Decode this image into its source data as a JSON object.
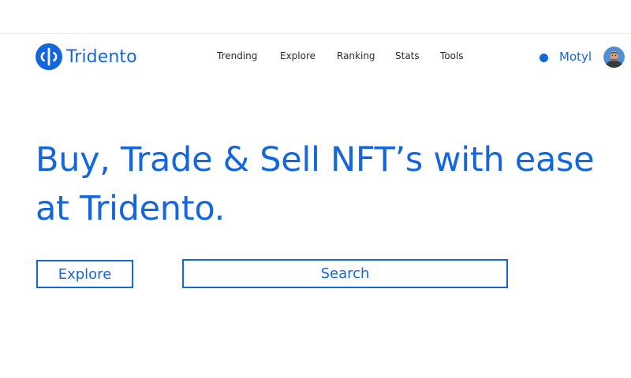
{
  "brand": {
    "name": "Tridento",
    "color": "#1466dc"
  },
  "nav": {
    "items": [
      {
        "label": "Trending"
      },
      {
        "label": "Explore"
      },
      {
        "label": "Ranking"
      },
      {
        "label": "Stats"
      },
      {
        "label": "Tools"
      }
    ]
  },
  "user": {
    "name": "Motyl",
    "status_color": "#1466dc",
    "avatar_icon": "user-avatar"
  },
  "hero": {
    "headline": "Buy, Trade & Sell NFT’s with ease at Tridento."
  },
  "actions": {
    "explore_label": "Explore",
    "search_label": "Search"
  },
  "colors": {
    "accent": "#1466dc",
    "nav_text": "#2b2b2b",
    "background": "#ffffff"
  }
}
